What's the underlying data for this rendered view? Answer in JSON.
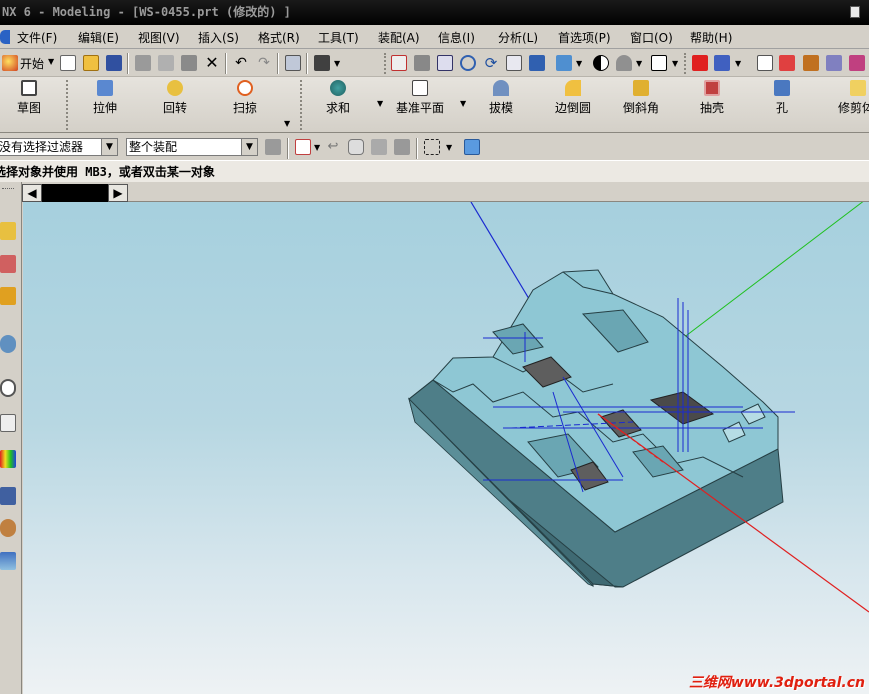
{
  "window": {
    "title": "NX 6 - Modeling - [WS-0455.prt  (修改的) ]"
  },
  "menu": {
    "items": [
      "文件(F)",
      "编辑(E)",
      "视图(V)",
      "插入(S)",
      "格式(R)",
      "工具(T)",
      "装配(A)",
      "信息(I)",
      "分析(L)",
      "首选项(P)",
      "窗口(O)",
      "帮助(H)"
    ]
  },
  "toolbar": {
    "start_label": "开始"
  },
  "features": {
    "items": [
      {
        "label": "草图",
        "icon": "sketch-icon"
      },
      {
        "label": "拉伸",
        "icon": "extrude-icon"
      },
      {
        "label": "回转",
        "icon": "revolve-icon"
      },
      {
        "label": "扫掠",
        "icon": "sweep-icon"
      },
      {
        "label": "求和",
        "icon": "unite-icon"
      },
      {
        "label": "基准平面",
        "icon": "datum-plane-icon"
      },
      {
        "label": "拔模",
        "icon": "draft-icon"
      },
      {
        "label": "边倒圆",
        "icon": "edge-blend-icon"
      },
      {
        "label": "倒斜角",
        "icon": "chamfer-icon"
      },
      {
        "label": "抽壳",
        "icon": "shell-icon"
      },
      {
        "label": "孔",
        "icon": "hole-icon"
      },
      {
        "label": "修剪体",
        "icon": "trim-body-icon"
      }
    ]
  },
  "selection": {
    "filter_value": "没有选择过滤器",
    "scope_value": "整个装配"
  },
  "status": {
    "prompt": "选择对象并使用 MB3，或者双击某一对象"
  },
  "watermark": {
    "text": "三维网www.3dportal.cn"
  },
  "colors": {
    "viewport_top": "#a6d0de",
    "part_face": "#8ec7d4",
    "part_side": "#4e7e88",
    "axis_x": "#e02020",
    "axis_y": "#20c020",
    "axis_z": "#1a2ad0",
    "watermark": "#e02010"
  }
}
